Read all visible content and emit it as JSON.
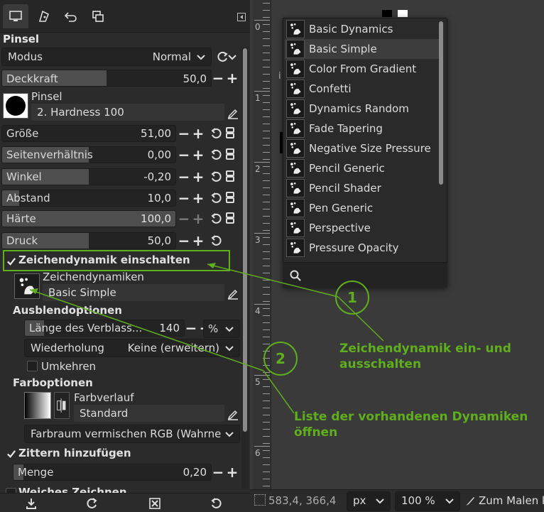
{
  "tabs": [
    {
      "name": "tool-options",
      "icon": "monitor-icon"
    },
    {
      "name": "device-status",
      "icon": "device-icon"
    },
    {
      "name": "undo-history",
      "icon": "undo-icon"
    },
    {
      "name": "images",
      "icon": "images-icon"
    }
  ],
  "panel": {
    "title": "Pinsel",
    "mode": {
      "label": "Modus",
      "value": "Normal"
    },
    "opacity": {
      "label": "Deckkraft",
      "value": "50,0",
      "fraction": 0.5
    },
    "brush": {
      "label": "Pinsel",
      "value": "2. Hardness 100"
    },
    "sliders": [
      {
        "label": "Größe",
        "value": "51,00",
        "fraction": 0.0
      },
      {
        "label": "Seitenverhältnis",
        "value": "0,00",
        "fraction": 0.5
      },
      {
        "label": "Winkel",
        "value": "-0,20",
        "fraction": 0.5
      },
      {
        "label": "Abstand",
        "value": "10,0",
        "fraction": 0.1
      },
      {
        "label": "Härte",
        "value": "100,0",
        "fraction": 1.0
      },
      {
        "label": "Druck",
        "value": "50,0",
        "fraction": 0.5
      }
    ],
    "dynamics_toggle": {
      "label": "Zeichendynamik einschalten",
      "checked": true
    },
    "dynamics": {
      "label": "Zeichendynamiken",
      "value": "Basic Simple"
    },
    "fade_options": {
      "title": "Ausblendoptionen",
      "fade_length": {
        "label": "Länge des Verblass...",
        "value": "140",
        "unit": "%"
      },
      "repeat": {
        "label": "Wiederholung",
        "value": "Keine (erweitern)"
      },
      "reverse": {
        "label": "Umkehren",
        "checked": false
      }
    },
    "color_options": {
      "title": "Farboptionen",
      "gradient_label": "Farbverlauf",
      "gradient_value": "Standard",
      "blend_space": "Farbraum vermischen RGB (Wahrne..."
    },
    "jitter": {
      "label": "Zittern hinzufügen",
      "checked": true
    },
    "amount": {
      "label": "Menge",
      "value": "0,20",
      "fraction": 0.05
    },
    "smooth": {
      "label": "Weiches Zeichnen"
    }
  },
  "dynamics_list": {
    "items": [
      "Basic Dynamics",
      "Basic Simple",
      "Color From Gradient",
      "Confetti",
      "Dynamics Random",
      "Fade Tapering",
      "Negative Size Pressure",
      "Pencil Generic",
      "Pencil Shader",
      "Pen Generic",
      "Perspective",
      "Pressure Opacity"
    ],
    "selected": "Basic Simple"
  },
  "status": {
    "coords": "583,4, 366,4",
    "unit": "px",
    "zoom": "100 %",
    "message": "Zum Malen k"
  },
  "ruler_labels": [
    "0",
    "1",
    "2",
    "3",
    "4",
    "5",
    "6"
  ],
  "annotations": {
    "one": "1",
    "two": "2",
    "text1_line1": "Zeichendynamik ein- und",
    "text1_line2": "ausschalten",
    "text2_line1": "Liste der vorhandenen Dynamiken",
    "text2_line2": "öffnen"
  },
  "colors": {
    "accent": "#5fae1e",
    "panel": "#2b2b2b",
    "canvas": "#3a3a3a"
  }
}
